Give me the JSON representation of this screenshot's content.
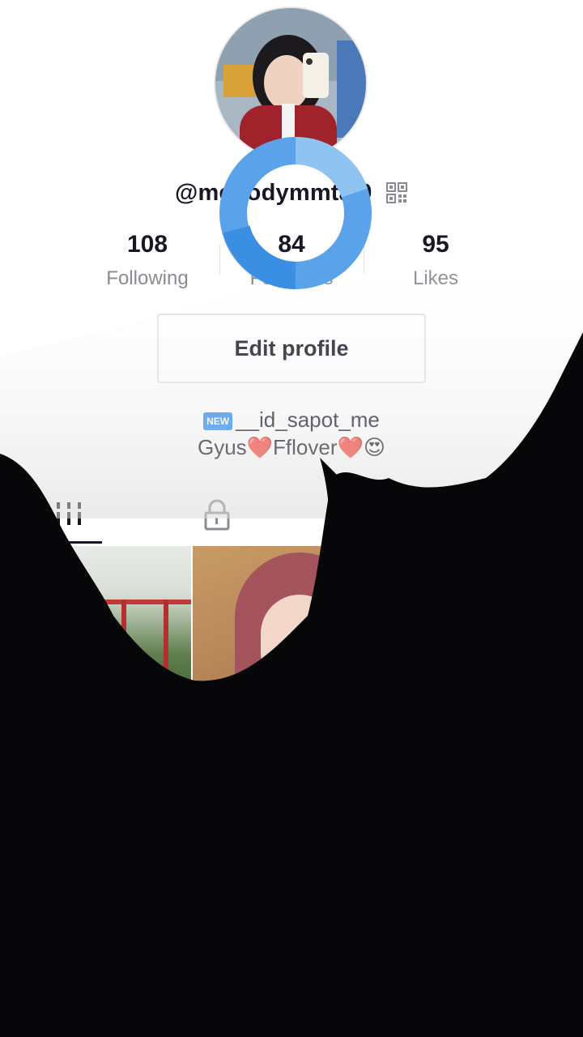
{
  "profile": {
    "username": "@meoodymmtal0",
    "qr_icon": "qr-code-icon",
    "avatar_icon": "profile-avatar"
  },
  "stats": {
    "following": {
      "value": "108",
      "label": "Following"
    },
    "followers": {
      "value": "84",
      "label": "Followers"
    },
    "likes": {
      "value": "95",
      "label": "Likes"
    }
  },
  "edit_profile_label": "Edit profile",
  "bio": {
    "badge": "NEW",
    "line1": "__id_sapot_me",
    "line2_prefix": "Gyus",
    "line2_heart1": "❤️",
    "line2_mid": "Fflover",
    "line2_heart2": "❤️",
    "line2_emoji": "😍"
  },
  "tabs": {
    "posts_icon": "grid-icon",
    "private_icon": "lock-icon"
  },
  "colors": {
    "text_primary": "#161823",
    "text_secondary": "#8a8b91",
    "loader_blue": "#3b8fe3",
    "loader_light": "#8ec3f2"
  }
}
